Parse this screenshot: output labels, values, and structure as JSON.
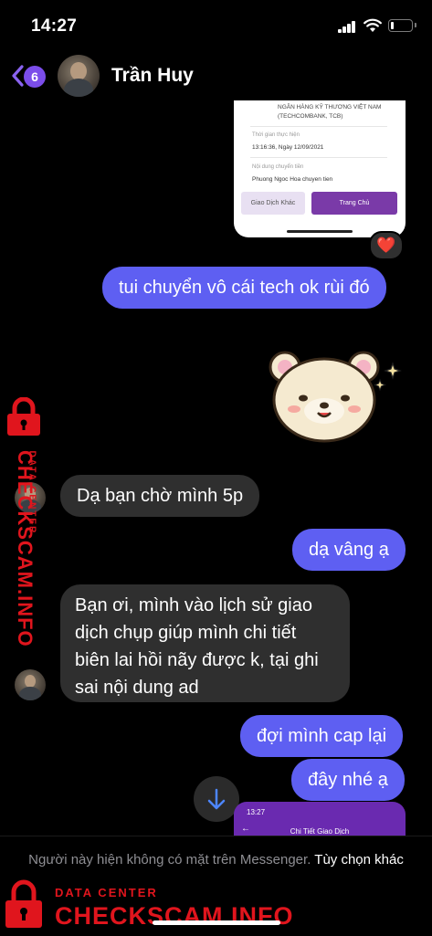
{
  "status_bar": {
    "time": "14:27"
  },
  "header": {
    "unread_count": "6",
    "contact_name": "Trần Huy"
  },
  "receipt": {
    "bank_line1": "NGÂN HÀNG KỸ THƯƠNG VIỆT NAM",
    "bank_line2": "(TECHCOMBANK, TCB)",
    "time_label": "Thời gian thực hiện",
    "time_value": "13:16:36, Ngày 12/09/2021",
    "content_label": "Nội dung chuyển tiền",
    "content_value": "Phuong Ngoc Hoa chuyen tien",
    "btn_other": "Giao Dịch Khác",
    "btn_home": "Trang Chủ"
  },
  "reaction": "❤️",
  "messages": [
    {
      "dir": "out",
      "text": "tui chuyển vô cái tech ok rùi đó"
    },
    {
      "dir": "in",
      "text": "Dạ bạn chờ mình 5p"
    },
    {
      "dir": "out",
      "text": "dạ vâng ạ"
    },
    {
      "dir": "in",
      "text": "Bạn ơi, mình vào lịch sử giao dịch chụp giúp mình chi tiết biên lai hồi nãy được k, tại ghi sai nội dung ad"
    },
    {
      "dir": "out",
      "text": "đợi mình cap lại"
    },
    {
      "dir": "out",
      "text": "đây nhé ạ"
    }
  ],
  "phone_shot": {
    "time": "13:27",
    "title": "Chi Tiết Giao Dịch"
  },
  "footer": {
    "notice": "Người này hiện không có mặt trên Messenger.",
    "more": "Tùy chọn khác"
  },
  "watermark": {
    "top": "DATA CENTER",
    "brand": "CHECKSCAM.INFO"
  },
  "colors": {
    "outgoing": "#5e5ff2",
    "incoming": "#2f2f2f",
    "accent": "#7b4dea",
    "watermark": "#e0151d"
  },
  "icons": [
    "back-chevron-icon",
    "signal-icon",
    "wifi-icon",
    "battery-icon",
    "heart-icon",
    "scroll-down-arrow-icon",
    "lock-icon"
  ]
}
